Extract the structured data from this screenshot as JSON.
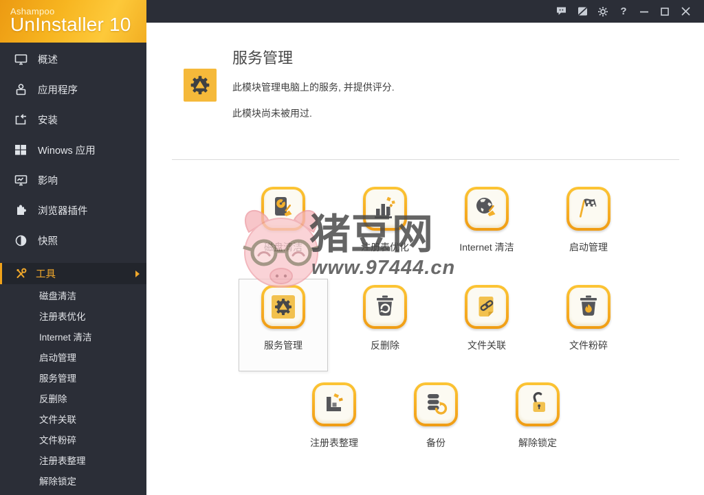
{
  "window": {
    "brand": "Ashampoo",
    "product": "UnInstaller 10",
    "help_glyph": "?",
    "titlebar_icons": [
      "feedback-bubble-icon",
      "review-panel-icon",
      "settings-gear-icon",
      "help-icon",
      "minimize-icon",
      "maximize-icon",
      "close-icon"
    ]
  },
  "sidebar": {
    "items": [
      {
        "label": "概述",
        "icon": "monitor-icon"
      },
      {
        "label": "应用程序",
        "icon": "package-icon"
      },
      {
        "label": "安装",
        "icon": "install-tray-icon"
      },
      {
        "label": "Winows 应用",
        "icon": "windows-logo-icon"
      },
      {
        "label": "影响",
        "icon": "impact-monitor-icon"
      },
      {
        "label": "浏览器插件",
        "icon": "puzzle-icon"
      },
      {
        "label": "快照",
        "icon": "snapshot-contrast-icon"
      },
      {
        "label": "工具",
        "icon": "tools-wrench-icon"
      }
    ],
    "tools_submenu": [
      "磁盘清洁",
      "注册表优化",
      "Internet 清洁",
      "启动管理",
      "服务管理",
      "反删除",
      "文件关联",
      "文件粉碎",
      "注册表整理",
      "解除锁定"
    ]
  },
  "main": {
    "header": {
      "title": "服务管理",
      "description": "此模块管理电脑上的服务, 并提供评分.",
      "status": "此模块尚未被用过."
    },
    "grid": {
      "selected_label": "服务管理",
      "items": [
        {
          "label": "磁盘清洁",
          "icon": "disk-cleaner-icon"
        },
        {
          "label": "注册表优化",
          "icon": "registry-optimizer-icon"
        },
        {
          "label": "Internet 清洁",
          "icon": "internet-cleaner-icon"
        },
        {
          "label": "启动管理",
          "icon": "startup-manager-icon"
        },
        {
          "label": "服务管理",
          "icon": "service-manager-icon"
        },
        {
          "label": "反删除",
          "icon": "undelete-icon"
        },
        {
          "label": "文件关联",
          "icon": "file-association-icon"
        },
        {
          "label": "文件粉碎",
          "icon": "file-shredder-icon"
        },
        {
          "label": "注册表整理",
          "icon": "registry-defrag-icon"
        },
        {
          "label": "备份",
          "icon": "backup-icon"
        },
        {
          "label": "解除锁定",
          "icon": "unlock-icon"
        }
      ]
    }
  },
  "watermark": {
    "site_name": "猪豆网",
    "site_url": "www.97444.cn"
  },
  "colors": {
    "accent_orange": "#f0a21a",
    "accent_yellow": "#fdc63a",
    "titlebar_bg": "#2b2e37",
    "sidebar_bg": "#2b2e37",
    "tools_row_bg": "#22252c",
    "glyph_dark": "#55565a",
    "glyph_yellow": "#f3b02c",
    "selected_border": "#cbcbcb"
  }
}
